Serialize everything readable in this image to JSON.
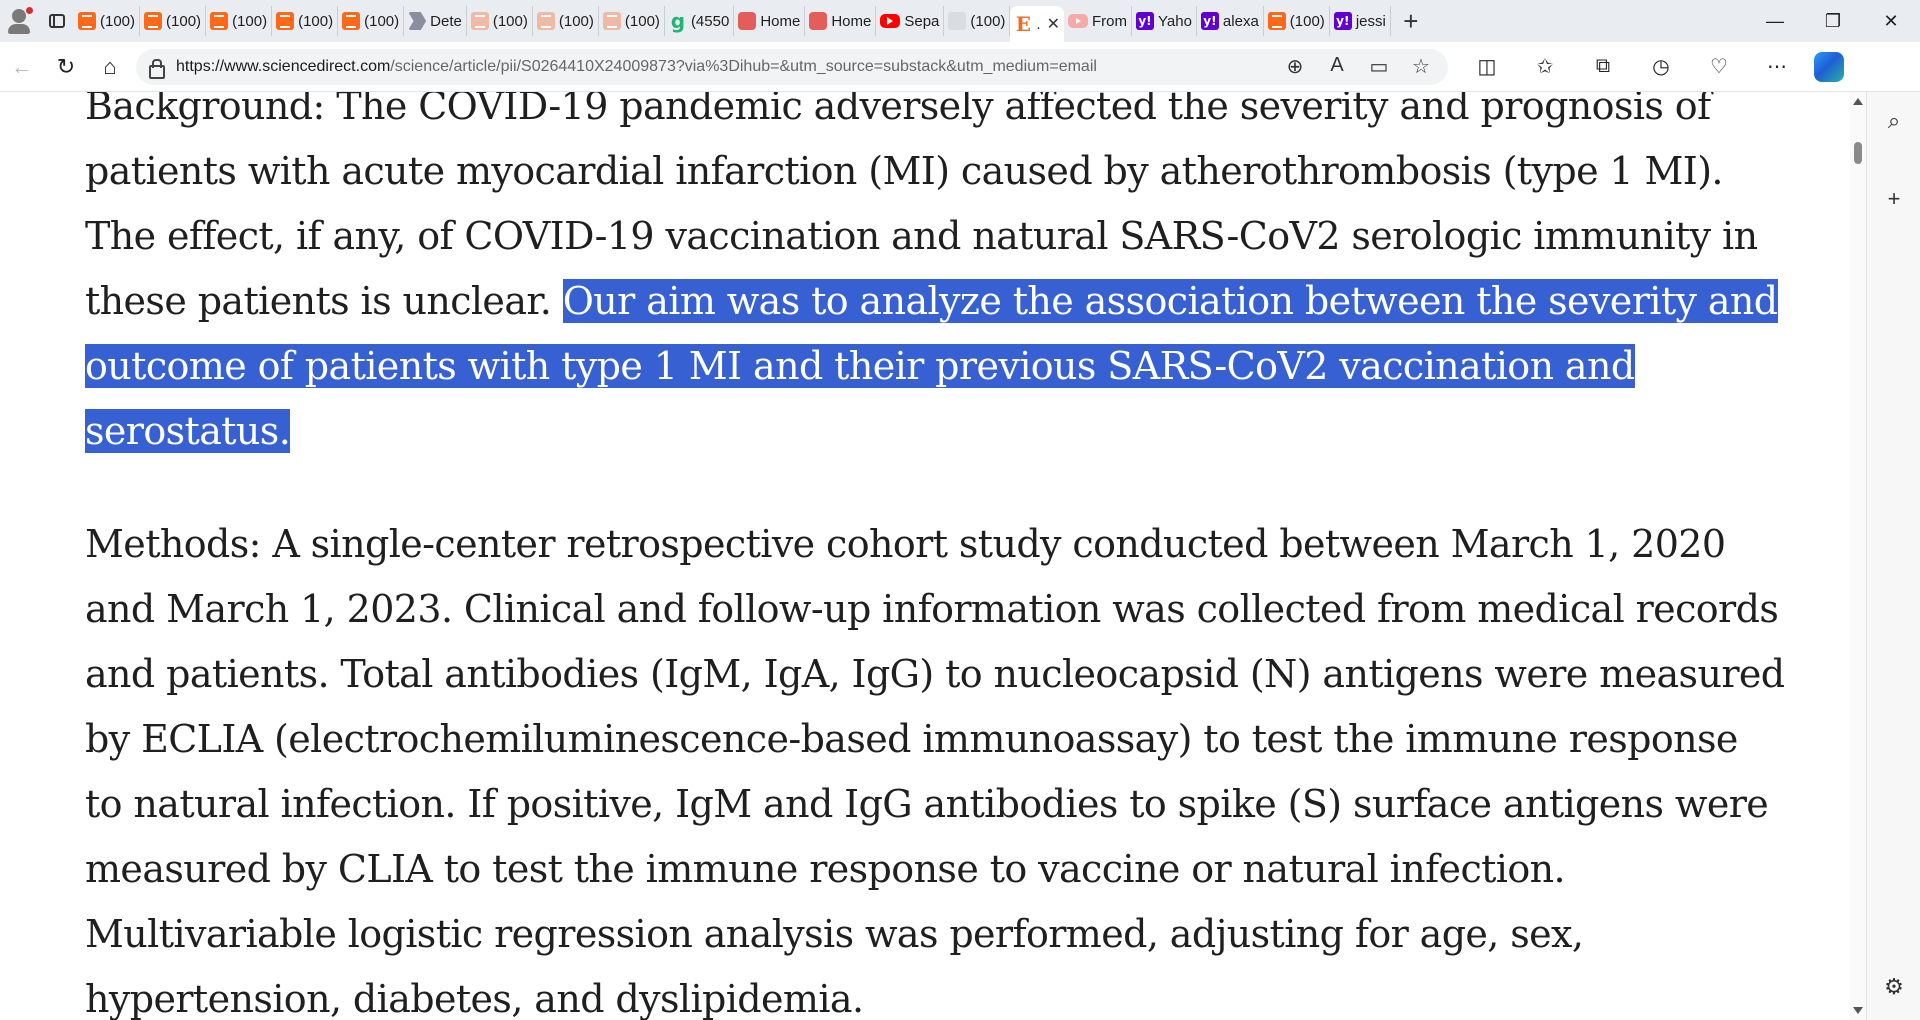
{
  "browser": {
    "tabs": [
      {
        "icon": "substack-icon",
        "label": "(100)"
      },
      {
        "icon": "substack-icon",
        "label": "(100)"
      },
      {
        "icon": "substack-icon",
        "label": "(100)"
      },
      {
        "icon": "substack-icon",
        "label": "(100)"
      },
      {
        "icon": "substack-icon",
        "label": "(100)"
      },
      {
        "icon": "detector-icon",
        "label": "Dete"
      },
      {
        "icon": "substack-faded-icon",
        "label": "(100)"
      },
      {
        "icon": "substack-faded-icon",
        "label": "(100)"
      },
      {
        "icon": "substack-faded-icon",
        "label": "(100)"
      },
      {
        "icon": "grammarly-icon",
        "label": "(4550"
      },
      {
        "icon": "home-icon",
        "label": "Home"
      },
      {
        "icon": "home-icon",
        "label": "Home"
      },
      {
        "icon": "youtube-icon",
        "label": "Sepa"
      },
      {
        "icon": "blank-page-icon",
        "label": "(100)"
      },
      {
        "icon": "ebook-icon",
        "label": "."
      },
      {
        "icon": "youtube-faded-icon",
        "label": "From"
      },
      {
        "icon": "yahoo-icon",
        "label": "Yaho"
      },
      {
        "icon": "yahoo-icon",
        "label": "alexa"
      },
      {
        "icon": "substack-icon",
        "label": "(100)"
      },
      {
        "icon": "yahoo-icon",
        "label": "jessi"
      }
    ],
    "new_tab_symbol": "+",
    "url_host": "https://www.sciencedirect.com",
    "url_path": "/science/article/pii/S0264410X24009873?via%3Dihub=&utm_source=substack&utm_medium=email"
  },
  "article": {
    "background_plain": "Background: The COVID-19 pandemic adversely affected the severity and prognosis of patients with acute myocardial infarction (MI) caused by atherothrombosis (type 1 MI). The effect, if any, of COVID-19 vaccination and natural SARS-CoV2 serologic immunity in these patients is unclear. ",
    "background_selected": "Our aim was to analyze the association between the severity and outcome of patients with type 1 MI and their previous SARS-CoV2 vaccination and serostatus.",
    "methods": "Methods: A single-center retrospective cohort study conducted between March 1, 2020 and March 1, 2023. Clinical and follow-up information was collected from medical records and patients. Total antibodies (IgM, IgA, IgG) to nucleocapsid (N) antigens were measured by ECLIA (electrochemiluminescence-based immunoassay) to test the immune response to natural infection. If positive, IgM and IgG antibodies to spike (S) surface antigens were measured by CLIA to test the immune response to vaccine or natural infection. Multivariable logistic regression analysis was performed, adjusting for age, sex, hypertension, diabetes, and dyslipidemia."
  },
  "colors": {
    "selection": "#3760d3",
    "tabstrip": "#e9edf1"
  }
}
